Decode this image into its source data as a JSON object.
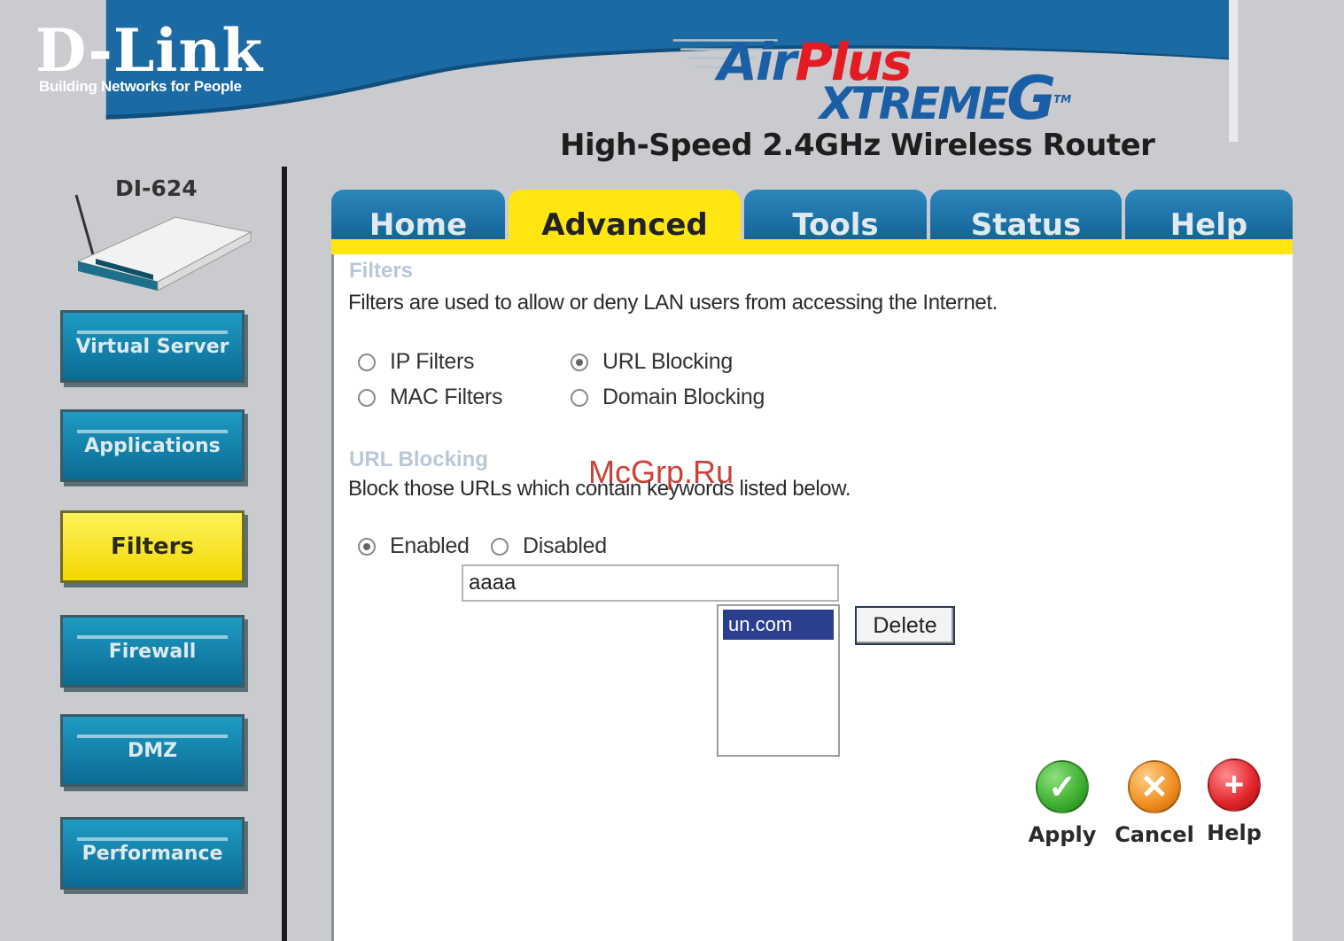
{
  "header": {
    "brand": "D-Link",
    "tagline": "Building Networks for People",
    "product_line_1a": "Air",
    "product_line_1b": "Plus",
    "product_line_2": "XTREME",
    "product_line_2_g": "G",
    "trademark": "TM",
    "subtitle": "High-Speed 2.4GHz Wireless Router"
  },
  "sidebar": {
    "model": "DI-624",
    "items": [
      {
        "label": "Virtual Server",
        "active": false
      },
      {
        "label": "Applications",
        "active": false
      },
      {
        "label": "Filters",
        "active": true
      },
      {
        "label": "Firewall",
        "active": false
      },
      {
        "label": "DMZ",
        "active": false
      },
      {
        "label": "Performance",
        "active": false
      }
    ]
  },
  "tabs": [
    {
      "label": "Home",
      "active": false
    },
    {
      "label": "Advanced",
      "active": true
    },
    {
      "label": "Tools",
      "active": false
    },
    {
      "label": "Status",
      "active": false
    },
    {
      "label": "Help",
      "active": false
    }
  ],
  "filters": {
    "title": "Filters",
    "description": "Filters are used to allow or deny LAN users from accessing the Internet.",
    "options": [
      {
        "label": "IP Filters",
        "selected": false
      },
      {
        "label": "URL Blocking",
        "selected": true
      },
      {
        "label": "MAC Filters",
        "selected": false
      },
      {
        "label": "Domain Blocking",
        "selected": false
      }
    ]
  },
  "url_blocking": {
    "title": "URL Blocking",
    "description": "Block those URLs which contain keywords listed below.",
    "enabled_label": "Enabled",
    "disabled_label": "Disabled",
    "enabled": true,
    "keyword_value": "aaaa",
    "list_items": [
      "un.com"
    ],
    "delete_label": "Delete"
  },
  "actions": [
    {
      "label": "Apply",
      "icon": "check-icon",
      "color": "#3cae2f",
      "glyph": "✓"
    },
    {
      "label": "Cancel",
      "icon": "cancel-icon",
      "color": "#f08c1e",
      "glyph": "✕"
    },
    {
      "label": "Help",
      "icon": "help-plus-icon",
      "color": "#e0242a",
      "glyph": "+"
    }
  ],
  "watermark": "McGrp.Ru",
  "colors": {
    "header_blue": "#1b6aa3",
    "tab_blue": "#1a73a8",
    "active_yellow": "#ffe611",
    "sidebar_teal": "#1188b3"
  }
}
